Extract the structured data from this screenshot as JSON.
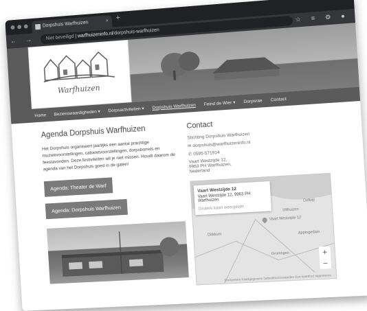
{
  "browser": {
    "tab_title": "Dorpshuis Warfhuizen",
    "tab_close": "×",
    "new_tab": "+",
    "security": "Niet beveiligd",
    "url_domain": "warfhuizeninfo.nl",
    "url_path": "/dorpshuis-warfhuizen",
    "nav_icons": "← → C",
    "right_icons": "☆ ≡ ⚙ ●"
  },
  "site": {
    "logo_text": "Warfhuizen",
    "menu": [
      "Home",
      "Bezienswaardigheden ▾",
      "Dorpsactiviteiten ▾",
      "Dorpshuis Warfhuizen",
      "Feind de Wier ▾",
      "Dorpsrae",
      "Contact"
    ],
    "active_menu": "Dorpshuis Warfhuizen"
  },
  "agenda": {
    "heading": "Agenda Dorpshuis Warfhuizen",
    "intro": "Het Dorpshuis organiseert jaarlijks een aantal prachtige muziekvoorstellingen, cabaretvoorstellingen, dorpsborrels en feestavonden. Deze festiviteiten wil je niet missen. Houdt daarom de agenda van het Dorpshuis goed in de gaten!",
    "btn1": "Agenda: Theater de Warf",
    "btn2": "Agenda: Dorpshuis Warfhuizen"
  },
  "contact": {
    "heading": "Contact",
    "org": "Stichting Dorpshuis Warfhuizen",
    "email": "✉ dorpshuis@warfhuizeninfo.nl",
    "phone": "✆ 0595-571914",
    "address1": "Vaart Westzijde 12,",
    "address2": "9963 PH Warfhuizen,",
    "address3": "Nederland"
  },
  "map": {
    "card_title": "Vaart Westzijde 12",
    "card_addr": "Vaart Westzijde 12, 9963 PH Warfhuizen",
    "card_link": "Grotere kaart weergeven",
    "pin_label": "Vaart Westzijde 12",
    "labels": [
      "Uithuizen",
      "Delfzijl",
      "Appingedam",
      "Groningen",
      "Dokkum"
    ],
    "zoom_in": "+",
    "zoom_out": "−",
    "attribution": "Sneltoetsen   Kaartgegevens   Gebruiksvoorwaarden   Een kaartfout rapporteren"
  }
}
